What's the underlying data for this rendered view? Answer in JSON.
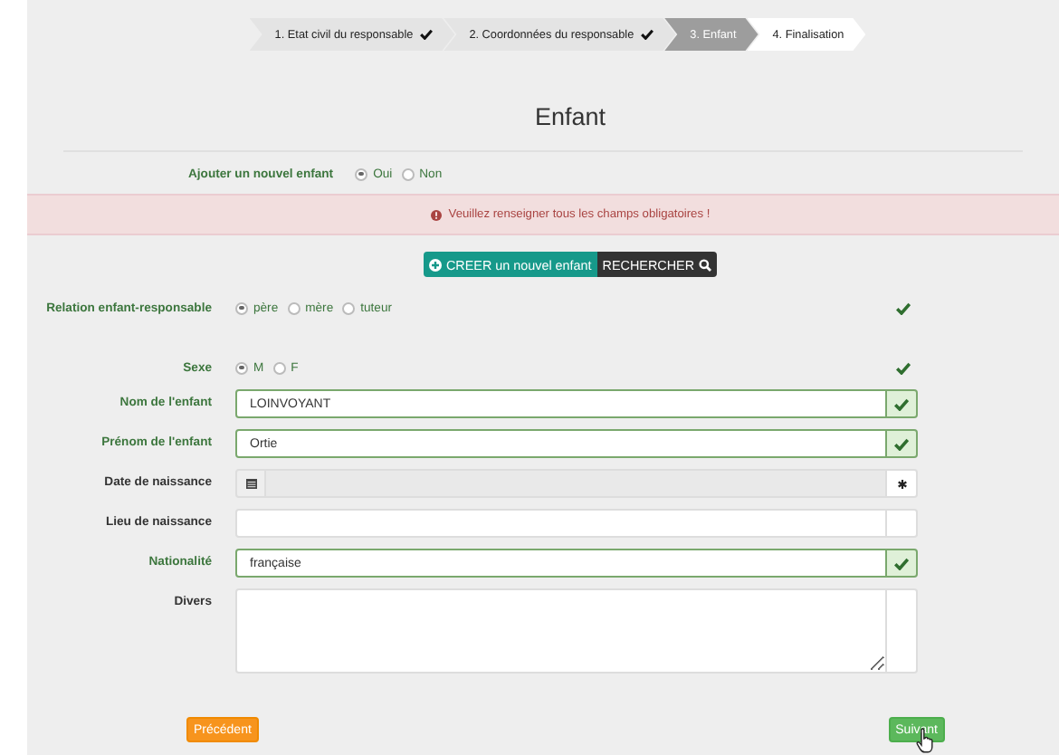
{
  "wizard": {
    "steps": [
      {
        "label": "1. Etat civil du responsable",
        "completed": true,
        "selected": false
      },
      {
        "label": "2. Coordonnées du responsable",
        "completed": true,
        "selected": false
      },
      {
        "label": "3. Enfant",
        "completed": false,
        "selected": true
      },
      {
        "label": "4. Finalisation",
        "completed": false,
        "selected": false
      }
    ]
  },
  "title": "Enfant",
  "new_child": {
    "label": "Ajouter un nouvel enfant",
    "options": [
      {
        "label": "Oui",
        "selected": true
      },
      {
        "label": "Non",
        "selected": false
      }
    ]
  },
  "alert": {
    "text": "Veuillez renseigner tous les champs obligatoires !"
  },
  "actions": [
    {
      "kind": "create",
      "label": "CREER un nouvel enfant"
    },
    {
      "kind": "search",
      "label": "RECHERCHER"
    }
  ],
  "fields": [
    {
      "kind": "radio",
      "label": "Relation enfant-responsable",
      "valid": true,
      "options": [
        {
          "label": "père",
          "selected": true
        },
        {
          "label": "mère",
          "selected": false
        },
        {
          "label": "tuteur",
          "selected": false
        }
      ]
    },
    {
      "kind": "radio",
      "label": "Sexe",
      "valid": true,
      "options": [
        {
          "label": "M",
          "selected": true
        },
        {
          "label": "F",
          "selected": false
        }
      ]
    },
    {
      "kind": "text",
      "label": "Nom de l'enfant",
      "value": "LOINVOYANT",
      "valid": true
    },
    {
      "kind": "text",
      "label": "Prénom de l'enfant",
      "value": "Ortie",
      "valid": true
    },
    {
      "kind": "date",
      "label": "Date de naissance",
      "valid": false,
      "disabled": true,
      "required": true
    },
    {
      "kind": "text",
      "label": "Lieu de naissance",
      "valid": false
    },
    {
      "kind": "text",
      "label": "Nationalité",
      "value": "française",
      "valid": true
    },
    {
      "kind": "textarea",
      "label": "Divers",
      "valid": false
    }
  ],
  "navigation": [
    {
      "kind": "previous",
      "label": "Précédent"
    },
    {
      "kind": "next",
      "label": "Suivant"
    }
  ]
}
